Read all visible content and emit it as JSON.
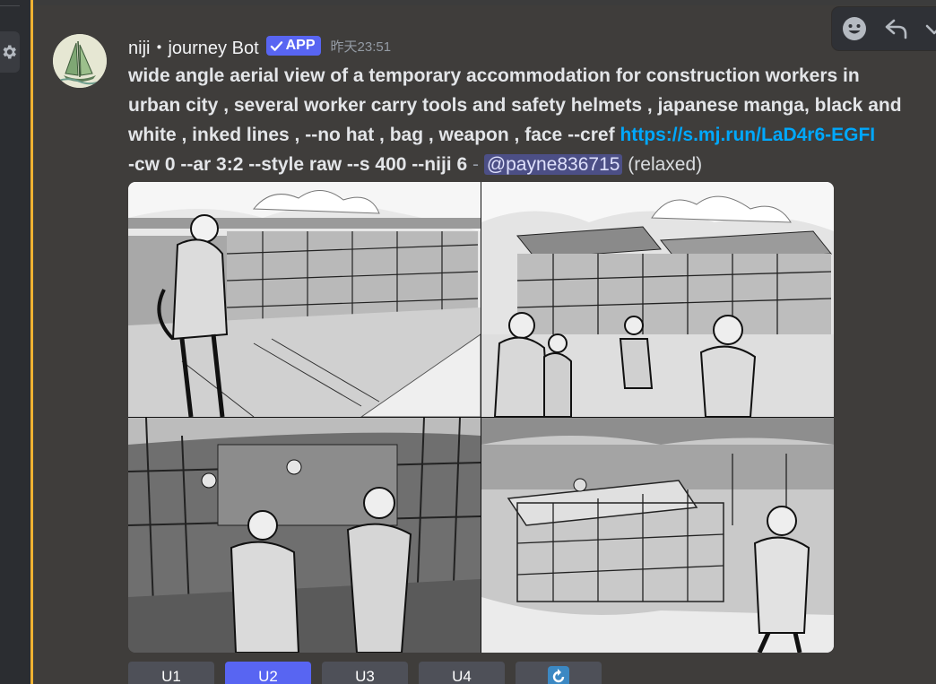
{
  "message": {
    "author": "niji・journey Bot",
    "badge": "APP",
    "timestamp": "昨天23:51",
    "prompt_lines": [
      "wide angle aerial view of a temporary accommodation for construction workers in",
      "urban city , several worker carry tools and safety helmets , japanese manga, black and",
      "white , inked lines , --no hat , bag , weapon , face --cref"
    ],
    "link": "https://s.mj.run/LaD4r6-EGFI",
    "params": "-cw 0 --ar 3:2 --style raw --s 400 --niji 6",
    "separator": "-",
    "mention": "@payne836715",
    "mode": "(relaxed)"
  },
  "buttons": [
    {
      "label": "U1",
      "active": false
    },
    {
      "label": "U2",
      "active": true
    },
    {
      "label": "U3",
      "active": false
    },
    {
      "label": "U4",
      "active": false
    }
  ],
  "reroll_icon": "reroll-icon",
  "toolbar_icons": [
    "add-reaction-icon",
    "reply-icon",
    "more-icon"
  ],
  "colors": {
    "accent": "#5865f2",
    "link": "#00a8fc",
    "mention_bg": "#4c4f86",
    "mention_bar": "#f0b232"
  }
}
